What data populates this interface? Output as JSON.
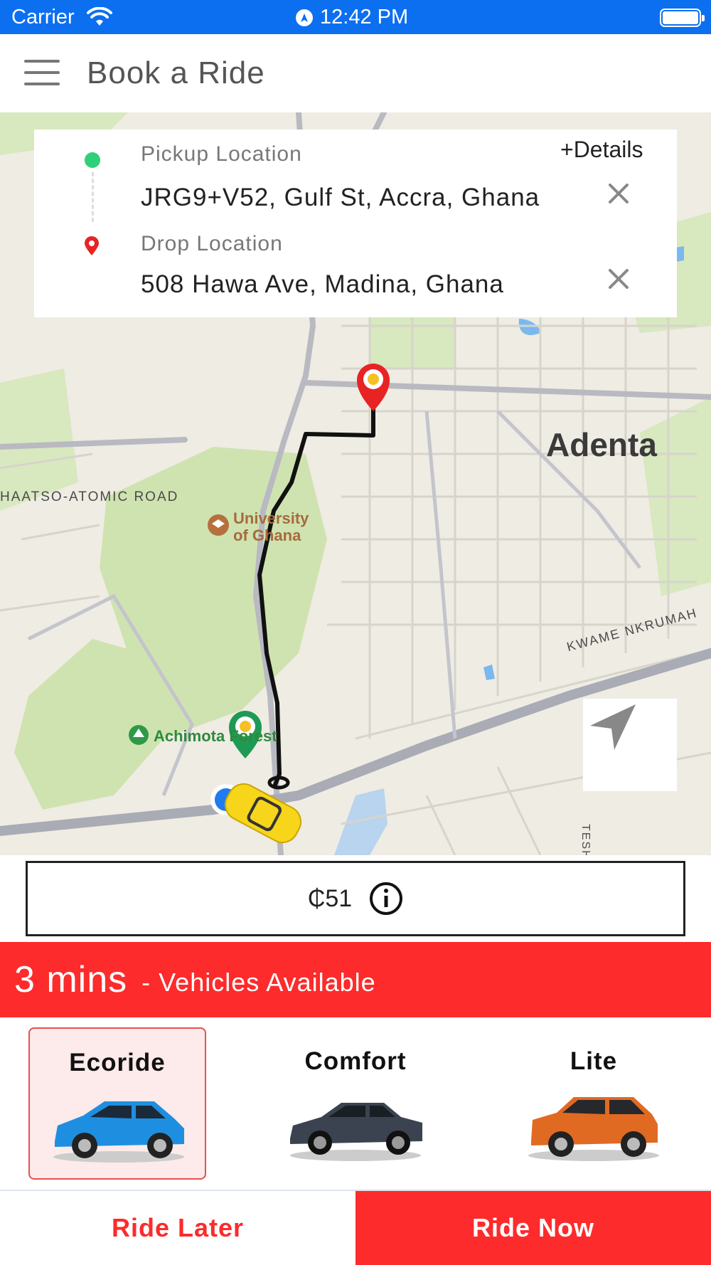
{
  "status_bar": {
    "carrier": "Carrier",
    "time": "12:42 PM",
    "icons": [
      "wifi-icon",
      "location-arrow-icon",
      "battery-icon"
    ]
  },
  "header": {
    "title": "Book a Ride",
    "menu_icon": "hamburger-menu-icon"
  },
  "locations": {
    "details_link": "+Details",
    "pickup": {
      "label": "Pickup Location",
      "value": "JRG9+V52, Gulf St, Accra, Ghana"
    },
    "drop": {
      "label": "Drop Location",
      "value": "508 Hawa Ave, Madina, Ghana"
    }
  },
  "map": {
    "labels": {
      "area": "Adenta",
      "road_1": "HAATSO-ATOMIC ROAD",
      "university_line1": "University",
      "university_line2": "of Ghana",
      "forest": "Achimota Forest",
      "road_2": "KWAME NKRUMAH",
      "road_3": "TESHIE"
    },
    "recenter_icon": "navigation-arrow-icon"
  },
  "fare": {
    "amount": "₵51",
    "info_icon": "info-icon"
  },
  "eta": {
    "time": "3 mins",
    "subtitle": "- Vehicles Available"
  },
  "vehicles": [
    {
      "name": "Ecoride",
      "selected": true,
      "color": "#1e8fe0"
    },
    {
      "name": "Comfort",
      "selected": false,
      "color": "#3b4250"
    },
    {
      "name": "Lite",
      "selected": false,
      "color": "#e06a22"
    }
  ],
  "actions": {
    "ride_later": "Ride Later",
    "ride_now": "Ride Now"
  },
  "colors": {
    "accent_red": "#fd2b2b",
    "status_blue": "#0b6ff0",
    "pickup_green": "#2ed07a"
  }
}
